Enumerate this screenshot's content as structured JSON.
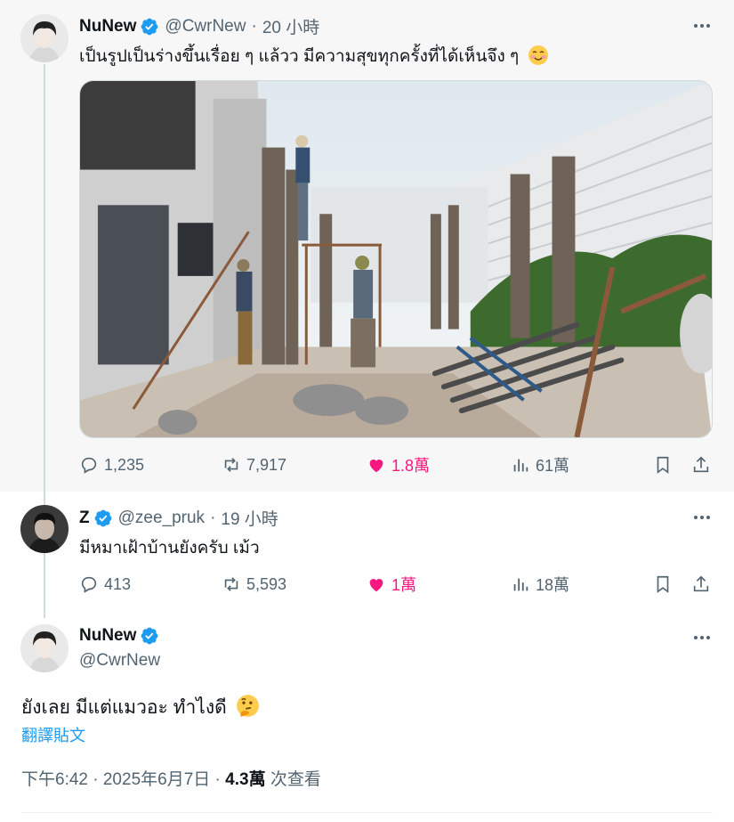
{
  "colors": {
    "accent": "#1d9bf0",
    "like": "#f91880",
    "muted": "#536471",
    "text": "#0f1419"
  },
  "tweet1": {
    "name": "NuNew",
    "handle": "@CwrNew",
    "time": "20 小時",
    "text": "เป็นรูปเป็นร่างขึ้นเรื่อย ๆ แล้วว มีความสุขทุกครั้งที่ได้เห็นจึง ๆ",
    "emoji": "smiling-face-with-blush-emoji",
    "stats": {
      "replies": "1,235",
      "reposts": "7,917",
      "likes": "1.8萬",
      "views": "61萬"
    }
  },
  "tweet2": {
    "name": "Z",
    "handle": "@zee_pruk",
    "time": "19 小時",
    "text": "มีหมาเฝ้าบ้านยังครับ เม้ว",
    "stats": {
      "replies": "413",
      "reposts": "5,593",
      "likes": "1萬",
      "views": "18萬"
    }
  },
  "tweet3": {
    "name": "NuNew",
    "handle": "@CwrNew",
    "text": "ยังเลย มีแต่แมวอะ ทำไงดี",
    "emoji": "thinking-face-emoji",
    "translate": "翻譯貼文",
    "timestamp": "下午6:42 · 2025年6月7日 · ",
    "views_count": "4.3萬",
    "views_label": " 次查看"
  },
  "separator": " · "
}
